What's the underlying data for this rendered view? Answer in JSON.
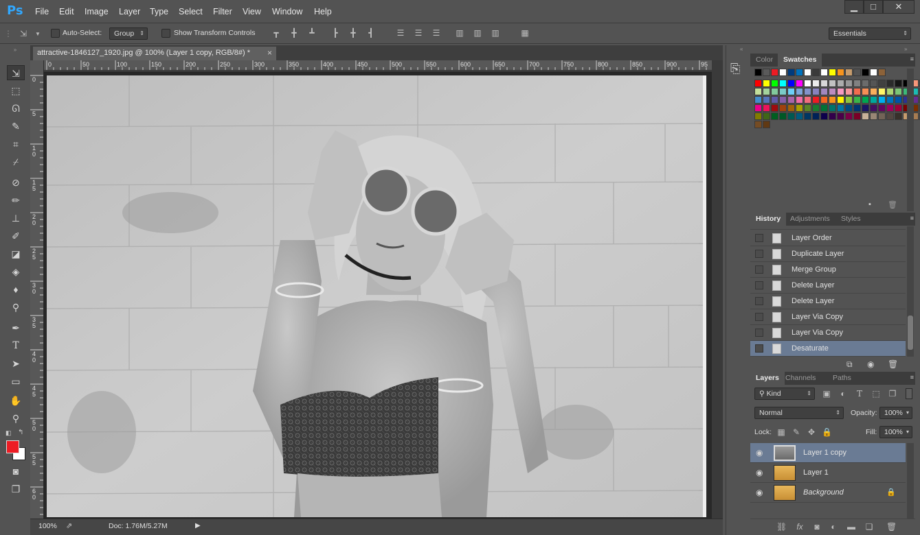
{
  "app": {
    "logo": "Ps"
  },
  "menu": [
    "File",
    "Edit",
    "Image",
    "Layer",
    "Type",
    "Select",
    "Filter",
    "View",
    "Window",
    "Help"
  ],
  "window_controls": {
    "minimize": "▁",
    "maximize": "□",
    "close": "✕"
  },
  "options_bar": {
    "auto_select_label": "Auto-Select:",
    "auto_select_value": "Group",
    "show_transform_label": "Show Transform Controls",
    "workspace": "Essentials"
  },
  "document": {
    "tab_title": "attractive-1846127_1920.jpg @ 100% (Layer 1 copy, RGB/8#) *",
    "close": "×",
    "zoom": "100%",
    "doc_size": "Doc: 1.76M/5.27M"
  },
  "ruler": {
    "h_ticks": [
      "0",
      "50",
      "100",
      "150",
      "200",
      "250",
      "300",
      "350",
      "400",
      "450",
      "500",
      "550",
      "600",
      "650",
      "700",
      "750",
      "800",
      "850",
      "900",
      "95"
    ],
    "v_ticks": [
      "0",
      "5",
      "1\n0",
      "1\n5",
      "2\n0",
      "2\n5",
      "3\n0",
      "3\n5",
      "4\n0",
      "4\n5",
      "5\n0",
      "5\n5",
      "6\n0"
    ]
  },
  "swatch_panel": {
    "tabs": [
      "Color",
      "Swatches"
    ],
    "active": "Swatches",
    "rows": [
      [
        "#000000",
        "#5a5a5a",
        "#ed1c24",
        "#ffffff",
        "#003b7d",
        "#0072bc",
        "#ffffff",
        "#3a3a3a",
        "#ffffff",
        "#ffff00",
        "#f7941d",
        "#c69c6d",
        "#535353",
        "#000000",
        "#ffffff",
        "#8c6239"
      ],
      [
        "#ff0000",
        "#ffff00",
        "#00ff00",
        "#00ffff",
        "#0000ff",
        "#ff00ff",
        "#ffffff",
        "#ebebeb",
        "#d7d7d7",
        "#c2c2c2",
        "#acacac",
        "#979797",
        "#818181",
        "#6b6b6b",
        "#555555",
        "#404040",
        "#2b2b2b",
        "#151515",
        "#000000",
        "#f7977a",
        "#fbad82",
        "#fdc68c",
        "#fff799"
      ],
      [
        "#c4df9b",
        "#a3d39c",
        "#82ca9c",
        "#7accc8",
        "#6dcff6",
        "#7da7d9",
        "#8393ca",
        "#8882be",
        "#a187be",
        "#bc8cbf",
        "#f49ac1",
        "#f5989d",
        "#f26c4f",
        "#f68e56",
        "#fbaf5d",
        "#fff568",
        "#acd373",
        "#7cc576",
        "#3cb878",
        "#1cbbb4",
        "#00bff3"
      ],
      [
        "#448ccb",
        "#5574b9",
        "#605ca8",
        "#8560a8",
        "#a864a8",
        "#f06eaa",
        "#f26d7d",
        "#ed1c24",
        "#f26522",
        "#f7941d",
        "#fff200",
        "#8dc63f",
        "#39b54a",
        "#00a651",
        "#00a99d",
        "#00aeef",
        "#0072bc",
        "#0054a6",
        "#2e3192",
        "#662d91",
        "#92278f"
      ],
      [
        "#ec008c",
        "#ed145b",
        "#9e0b0f",
        "#a0410d",
        "#a36209",
        "#aba000",
        "#598527",
        "#197b30",
        "#007236",
        "#00746b",
        "#0076a3",
        "#004a80",
        "#003471",
        "#1b1464",
        "#440e62",
        "#630460",
        "#9e005d",
        "#9e0039",
        "#790000",
        "#7b2e00",
        "#7d4900"
      ],
      [
        "#827b00",
        "#406618",
        "#005e20",
        "#005826",
        "#005952",
        "#005b7f",
        "#003663",
        "#002157",
        "#0d004c",
        "#32004b",
        "#4b0049",
        "#7b0046",
        "#7a0026",
        "#c7b299",
        "#998675",
        "#736357",
        "#534741",
        "#37302a",
        "#c69c6d",
        "#a67c52",
        "#8c6239"
      ],
      [
        "#754c24",
        "#603913"
      ]
    ]
  },
  "history_panel": {
    "tabs": [
      "History",
      "Adjustments",
      "Styles"
    ],
    "active": "History",
    "items": [
      "Layer Order",
      "Duplicate Layer",
      "Merge Group",
      "Delete Layer",
      "Delete Layer",
      "Layer Via Copy",
      "Layer Via Copy",
      "Desaturate"
    ],
    "selected_index": 7
  },
  "layers_panel": {
    "tabs": [
      "Layers",
      "Channels",
      "Paths"
    ],
    "active": "Layers",
    "filter_kind": "Kind",
    "blend_mode": "Normal",
    "opacity_label": "Opacity:",
    "opacity": "100%",
    "lock_label": "Lock:",
    "fill_label": "Fill:",
    "fill": "100%",
    "layers": [
      {
        "name": "Layer 1 copy",
        "selected": true,
        "grayscale": true,
        "locked": false
      },
      {
        "name": "Layer 1",
        "selected": false,
        "grayscale": false,
        "locked": false
      },
      {
        "name": "Background",
        "selected": false,
        "grayscale": false,
        "locked": true
      }
    ]
  },
  "colors": {
    "foreground": "#ed1c24",
    "background": "#ffffff",
    "selection": "#6a7b94"
  }
}
